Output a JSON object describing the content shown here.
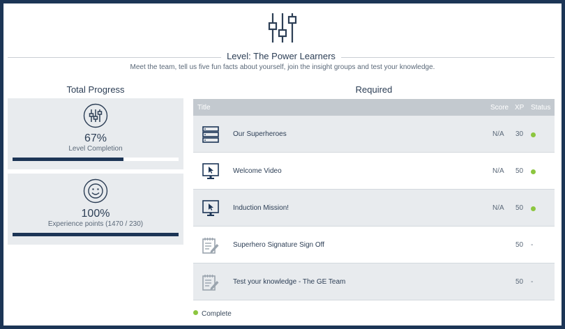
{
  "level": {
    "title": "Level: The Power Learners",
    "description": "Meet the team, tell us five fun facts about yourself, join the insight groups and test your knowledge.",
    "icon": "sliders-icon"
  },
  "progress": {
    "heading": "Total Progress",
    "cards": [
      {
        "icon": "sliders-icon",
        "percent": "67%",
        "label": "Level Completion",
        "fill": 0.67
      },
      {
        "icon": "smiley-icon",
        "percent": "100%",
        "label": "Experience points (1470 / 230)",
        "fill": 1.0
      }
    ]
  },
  "required": {
    "heading": "Required",
    "columns": {
      "title": "Title",
      "score": "Score",
      "xp": "XP",
      "status": "Status"
    },
    "rows": [
      {
        "icon": "server-stack-icon",
        "title": "Our Superheroes",
        "score": "N/A",
        "xp": "30",
        "status": "complete"
      },
      {
        "icon": "monitor-cursor-icon",
        "title": "Welcome Video",
        "score": "N/A",
        "xp": "50",
        "status": "complete"
      },
      {
        "icon": "monitor-cursor-icon",
        "title": "Induction Mission!",
        "score": "N/A",
        "xp": "50",
        "status": "complete"
      },
      {
        "icon": "notepad-pencil-icon",
        "title": "Superhero Signature Sign Off",
        "score": "",
        "xp": "50",
        "status": "-"
      },
      {
        "icon": "notepad-pencil-icon",
        "title": "Test your knowledge - The GE Team",
        "score": "",
        "xp": "50",
        "status": "-"
      }
    ]
  },
  "legend": {
    "complete_label": "Complete"
  },
  "colors": {
    "navy": "#1c3556",
    "complete_green": "#8cc63f",
    "header_gray": "#c3c9cf",
    "panel_gray": "#e8ebee"
  }
}
